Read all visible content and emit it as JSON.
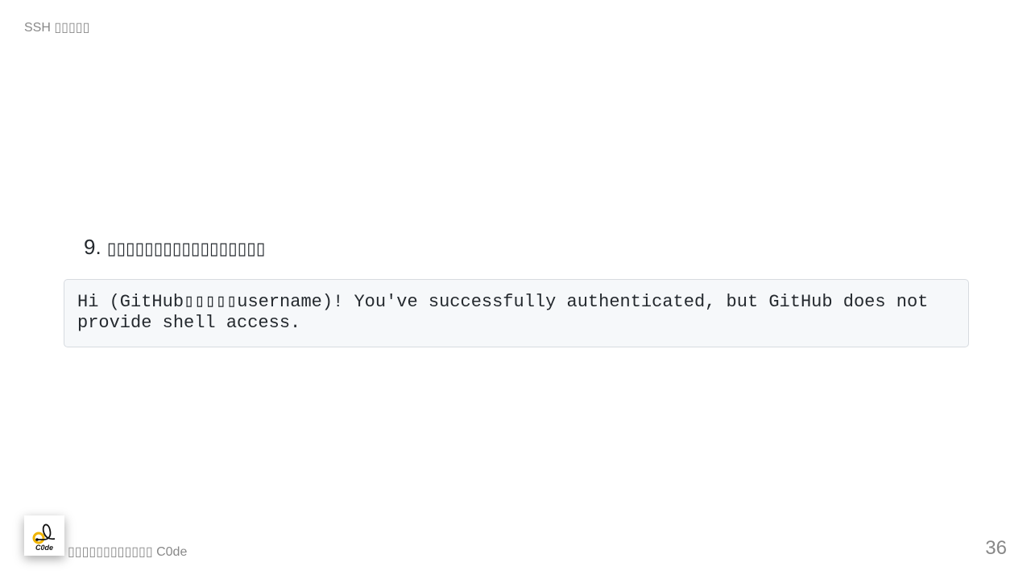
{
  "header": "SSH ▯▯▯▯▯",
  "heading": {
    "number": "9.",
    "text": "▯▯▯▯▯▯▯▯▯▯▯▯▯▯▯▯▯"
  },
  "code": "Hi (GitHub▯▯▯▯▯username)! You've successfully authenticated, but GitHub does not provide shell access.",
  "footer": "▯▯▯▯▯▯▯▯▯▯▯▯ C0de",
  "logo_text": "C0de",
  "page_number": "36"
}
